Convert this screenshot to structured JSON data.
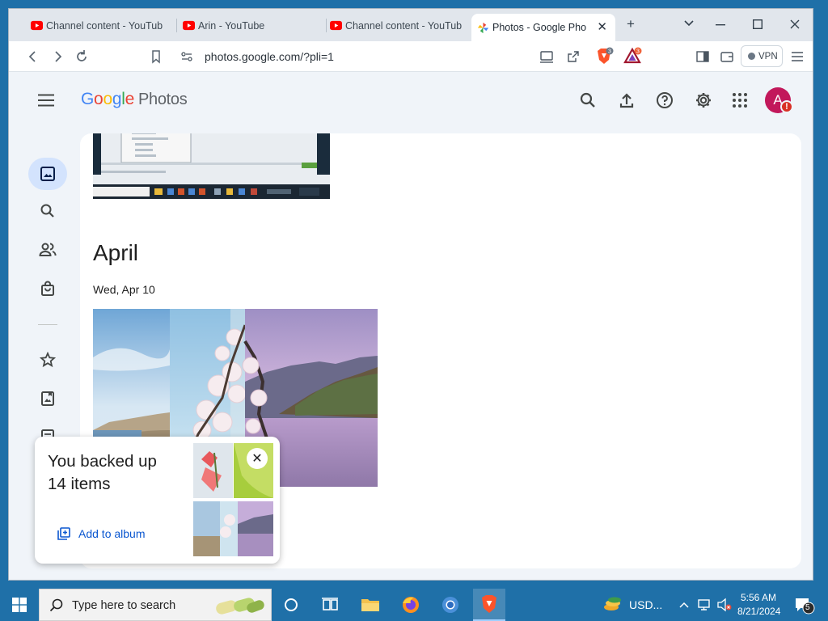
{
  "browser": {
    "tabs": [
      {
        "title": "Channel content - YouTub",
        "favicon": "youtube-icon",
        "active": false
      },
      {
        "title": "Arin - YouTube",
        "favicon": "youtube-icon",
        "active": false
      },
      {
        "title": "Channel content - YouTub",
        "favicon": "youtube-icon",
        "active": false
      },
      {
        "title": "Photos - Google Pho",
        "favicon": "google-photos-icon",
        "active": true
      }
    ],
    "url": "photos.google.com/?pli=1",
    "vpn_label": "VPN",
    "brave_shield_count": "3",
    "rewards_count": "3"
  },
  "app": {
    "logo_google": [
      "G",
      "o",
      "o",
      "g",
      "l",
      "e"
    ],
    "logo_product": "Photos",
    "avatar_initial": "A",
    "avatar_badge": "!"
  },
  "sidebar": {
    "items": [
      {
        "icon": "photos-icon",
        "active": true
      },
      {
        "icon": "search-icon",
        "active": false
      },
      {
        "icon": "sharing-icon",
        "active": false
      },
      {
        "icon": "print-store-icon",
        "active": false
      },
      {
        "icon": "star-icon",
        "active": false
      },
      {
        "icon": "albums-icon",
        "active": false
      },
      {
        "icon": "documents-icon",
        "active": false
      }
    ]
  },
  "content": {
    "month": "April",
    "date": "Wed, Apr 10"
  },
  "toast": {
    "title": "You backed up 14 items",
    "action": "Add to album",
    "close": "✕"
  },
  "taskbar": {
    "search_placeholder": "Type here to search",
    "currency": "USD...",
    "time": "5:56 AM",
    "date": "8/21/2024",
    "notification_count": "5"
  },
  "colors": {
    "accent": "#0b57d0",
    "active_rail": "#d3e3fd",
    "taskbar": "#1f70a8",
    "avatar": "#c2185b"
  }
}
